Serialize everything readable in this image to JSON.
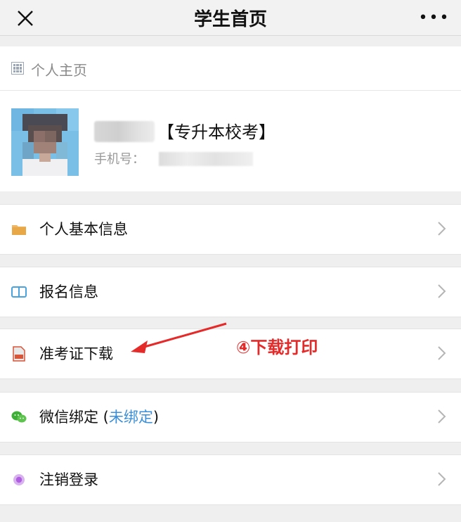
{
  "header": {
    "title": "学生首页",
    "more": "•••"
  },
  "profile": {
    "section_title": "个人主页",
    "tag": "【专升本校考】",
    "phone_label": "手机号："
  },
  "menu": [
    {
      "label": "个人基本信息",
      "icon": "folder-icon"
    },
    {
      "label": "报名信息",
      "icon": "book-icon"
    },
    {
      "label": "准考证下载",
      "icon": "pdf-icon"
    },
    {
      "label": "微信绑定 (",
      "status": "未绑定",
      "suffix": ")",
      "icon": "wechat-icon"
    },
    {
      "label": "注销登录",
      "icon": "logout-icon"
    }
  ],
  "annotation": {
    "text": "④下载打印",
    "color": "#e52a2a"
  },
  "colors": {
    "link": "#3a8fd8",
    "background": "#efefef"
  }
}
